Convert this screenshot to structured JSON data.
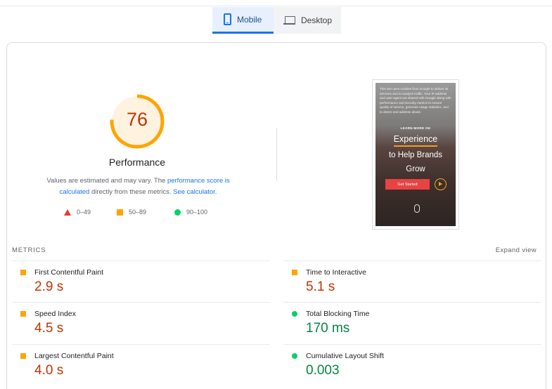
{
  "tabs": [
    {
      "label": "Mobile",
      "icon": "phone-icon",
      "active": true
    },
    {
      "label": "Desktop",
      "icon": "laptop-icon",
      "active": false
    }
  ],
  "performance": {
    "score": "76",
    "score_fraction": 0.76,
    "score_color": "#ffa400",
    "title": "Performance",
    "desc_prefix": "Values are estimated and may vary. The ",
    "desc_link1": "performance score is calculated",
    "desc_middle": " directly from these metrics. ",
    "desc_link2": "See calculator."
  },
  "legend": [
    {
      "range": "0–49",
      "shape": "triangle",
      "color": "#e53935"
    },
    {
      "range": "50–89",
      "shape": "square",
      "color": "#ffa400"
    },
    {
      "range": "90–100",
      "shape": "circle",
      "color": "#0cce6b"
    }
  ],
  "screenshot": {
    "intro_text": "This site uses cookies from Google to deliver its services and to analyze traffic. Your IP address and user-agent are shared with Google along with performance and security metrics to ensure quality of service, generate usage statistics, and to detect and address abuse.",
    "learn_more": "LEARN MORE    OK",
    "headline1": "Experience",
    "headline2": "to Help Brands",
    "headline3": "Grow",
    "cta": "Get Started"
  },
  "metrics": {
    "label": "METRICS",
    "expand": "Expand view",
    "items": [
      {
        "name": "First Contentful Paint",
        "value": "2.9 s",
        "status": "average"
      },
      {
        "name": "Time to Interactive",
        "value": "5.1 s",
        "status": "average"
      },
      {
        "name": "Speed Index",
        "value": "4.5 s",
        "status": "average"
      },
      {
        "name": "Total Blocking Time",
        "value": "170 ms",
        "status": "good"
      },
      {
        "name": "Largest Contentful Paint",
        "value": "4.0 s",
        "status": "average"
      },
      {
        "name": "Cumulative Layout Shift",
        "value": "0.003",
        "status": "good"
      }
    ]
  }
}
